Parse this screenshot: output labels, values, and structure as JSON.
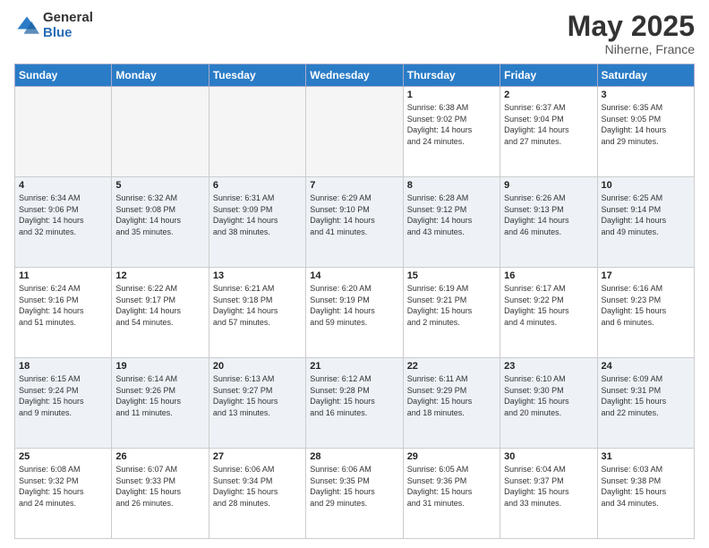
{
  "logo": {
    "general": "General",
    "blue": "Blue"
  },
  "title": "May 2025",
  "subtitle": "Niherne, France",
  "days_header": [
    "Sunday",
    "Monday",
    "Tuesday",
    "Wednesday",
    "Thursday",
    "Friday",
    "Saturday"
  ],
  "weeks": [
    [
      {
        "num": "",
        "info": ""
      },
      {
        "num": "",
        "info": ""
      },
      {
        "num": "",
        "info": ""
      },
      {
        "num": "",
        "info": ""
      },
      {
        "num": "1",
        "info": "Sunrise: 6:38 AM\nSunset: 9:02 PM\nDaylight: 14 hours\nand 24 minutes."
      },
      {
        "num": "2",
        "info": "Sunrise: 6:37 AM\nSunset: 9:04 PM\nDaylight: 14 hours\nand 27 minutes."
      },
      {
        "num": "3",
        "info": "Sunrise: 6:35 AM\nSunset: 9:05 PM\nDaylight: 14 hours\nand 29 minutes."
      }
    ],
    [
      {
        "num": "4",
        "info": "Sunrise: 6:34 AM\nSunset: 9:06 PM\nDaylight: 14 hours\nand 32 minutes."
      },
      {
        "num": "5",
        "info": "Sunrise: 6:32 AM\nSunset: 9:08 PM\nDaylight: 14 hours\nand 35 minutes."
      },
      {
        "num": "6",
        "info": "Sunrise: 6:31 AM\nSunset: 9:09 PM\nDaylight: 14 hours\nand 38 minutes."
      },
      {
        "num": "7",
        "info": "Sunrise: 6:29 AM\nSunset: 9:10 PM\nDaylight: 14 hours\nand 41 minutes."
      },
      {
        "num": "8",
        "info": "Sunrise: 6:28 AM\nSunset: 9:12 PM\nDaylight: 14 hours\nand 43 minutes."
      },
      {
        "num": "9",
        "info": "Sunrise: 6:26 AM\nSunset: 9:13 PM\nDaylight: 14 hours\nand 46 minutes."
      },
      {
        "num": "10",
        "info": "Sunrise: 6:25 AM\nSunset: 9:14 PM\nDaylight: 14 hours\nand 49 minutes."
      }
    ],
    [
      {
        "num": "11",
        "info": "Sunrise: 6:24 AM\nSunset: 9:16 PM\nDaylight: 14 hours\nand 51 minutes."
      },
      {
        "num": "12",
        "info": "Sunrise: 6:22 AM\nSunset: 9:17 PM\nDaylight: 14 hours\nand 54 minutes."
      },
      {
        "num": "13",
        "info": "Sunrise: 6:21 AM\nSunset: 9:18 PM\nDaylight: 14 hours\nand 57 minutes."
      },
      {
        "num": "14",
        "info": "Sunrise: 6:20 AM\nSunset: 9:19 PM\nDaylight: 14 hours\nand 59 minutes."
      },
      {
        "num": "15",
        "info": "Sunrise: 6:19 AM\nSunset: 9:21 PM\nDaylight: 15 hours\nand 2 minutes."
      },
      {
        "num": "16",
        "info": "Sunrise: 6:17 AM\nSunset: 9:22 PM\nDaylight: 15 hours\nand 4 minutes."
      },
      {
        "num": "17",
        "info": "Sunrise: 6:16 AM\nSunset: 9:23 PM\nDaylight: 15 hours\nand 6 minutes."
      }
    ],
    [
      {
        "num": "18",
        "info": "Sunrise: 6:15 AM\nSunset: 9:24 PM\nDaylight: 15 hours\nand 9 minutes."
      },
      {
        "num": "19",
        "info": "Sunrise: 6:14 AM\nSunset: 9:26 PM\nDaylight: 15 hours\nand 11 minutes."
      },
      {
        "num": "20",
        "info": "Sunrise: 6:13 AM\nSunset: 9:27 PM\nDaylight: 15 hours\nand 13 minutes."
      },
      {
        "num": "21",
        "info": "Sunrise: 6:12 AM\nSunset: 9:28 PM\nDaylight: 15 hours\nand 16 minutes."
      },
      {
        "num": "22",
        "info": "Sunrise: 6:11 AM\nSunset: 9:29 PM\nDaylight: 15 hours\nand 18 minutes."
      },
      {
        "num": "23",
        "info": "Sunrise: 6:10 AM\nSunset: 9:30 PM\nDaylight: 15 hours\nand 20 minutes."
      },
      {
        "num": "24",
        "info": "Sunrise: 6:09 AM\nSunset: 9:31 PM\nDaylight: 15 hours\nand 22 minutes."
      }
    ],
    [
      {
        "num": "25",
        "info": "Sunrise: 6:08 AM\nSunset: 9:32 PM\nDaylight: 15 hours\nand 24 minutes."
      },
      {
        "num": "26",
        "info": "Sunrise: 6:07 AM\nSunset: 9:33 PM\nDaylight: 15 hours\nand 26 minutes."
      },
      {
        "num": "27",
        "info": "Sunrise: 6:06 AM\nSunset: 9:34 PM\nDaylight: 15 hours\nand 28 minutes."
      },
      {
        "num": "28",
        "info": "Sunrise: 6:06 AM\nSunset: 9:35 PM\nDaylight: 15 hours\nand 29 minutes."
      },
      {
        "num": "29",
        "info": "Sunrise: 6:05 AM\nSunset: 9:36 PM\nDaylight: 15 hours\nand 31 minutes."
      },
      {
        "num": "30",
        "info": "Sunrise: 6:04 AM\nSunset: 9:37 PM\nDaylight: 15 hours\nand 33 minutes."
      },
      {
        "num": "31",
        "info": "Sunrise: 6:03 AM\nSunset: 9:38 PM\nDaylight: 15 hours\nand 34 minutes."
      }
    ]
  ]
}
